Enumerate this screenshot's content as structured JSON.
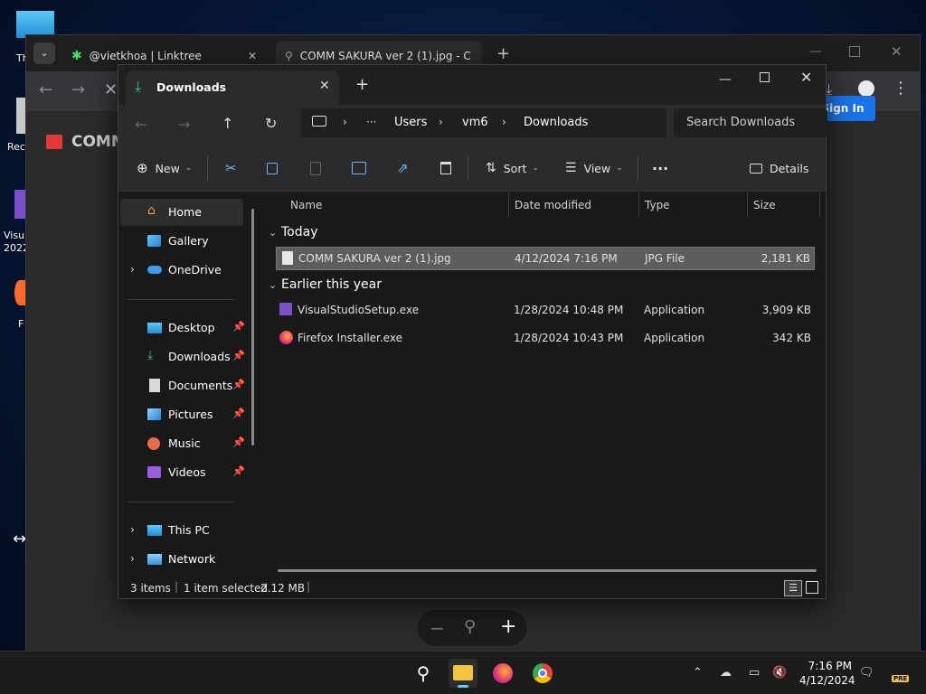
{
  "desktop": {
    "icons": [
      {
        "label": "Th"
      },
      {
        "label": "Rec"
      },
      {
        "label": "Visu 2022"
      },
      {
        "label": "F"
      }
    ]
  },
  "browser": {
    "tabs": [
      {
        "title": "@vietkhoa | Linktree",
        "active": false
      },
      {
        "title": "COMM SAKURA ver 2 (1).jpg - C",
        "active": true
      }
    ],
    "page_heading": "COMM",
    "sign_in_label": "Sign In",
    "zoom_minus": "−",
    "zoom_icon": "zoom-icon",
    "zoom_plus": "+"
  },
  "explorer": {
    "tab_title": "Downloads",
    "path": [
      "Users",
      "vm6",
      "Downloads"
    ],
    "path_more": "···",
    "search_placeholder": "Search Downloads",
    "commands": {
      "new": "New",
      "sort": "Sort",
      "view": "View",
      "more": "···",
      "details": "Details"
    },
    "nav": {
      "top": [
        {
          "label": "Home",
          "selected": true
        },
        {
          "label": "Gallery"
        },
        {
          "label": "OneDrive"
        }
      ],
      "quick": [
        {
          "label": "Desktop"
        },
        {
          "label": "Downloads"
        },
        {
          "label": "Documents"
        },
        {
          "label": "Pictures"
        },
        {
          "label": "Music"
        },
        {
          "label": "Videos"
        }
      ],
      "bottom": [
        {
          "label": "This PC"
        },
        {
          "label": "Network"
        }
      ]
    },
    "columns": [
      "Name",
      "Date modified",
      "Type",
      "Size"
    ],
    "groups": [
      {
        "label": "Today",
        "rows": [
          {
            "name": "COMM SAKURA ver 2 (1).jpg",
            "date": "4/12/2024 7:16 PM",
            "type": "JPG File",
            "size": "2,181 KB",
            "selected": true
          }
        ]
      },
      {
        "label": "Earlier this year",
        "rows": [
          {
            "name": "VisualStudioSetup.exe",
            "date": "1/28/2024 10:48 PM",
            "type": "Application",
            "size": "3,909 KB"
          },
          {
            "name": "Firefox Installer.exe",
            "date": "1/28/2024 10:43 PM",
            "type": "Application",
            "size": "342 KB"
          }
        ]
      }
    ],
    "status": {
      "items": "3 items",
      "selected": "1 item selected",
      "size": "2.12 MB"
    }
  },
  "taskbar": {
    "time": "7:16 PM",
    "date": "4/12/2024",
    "badge": "PRE"
  },
  "colors": {
    "accent": "#1a73e8",
    "selection": "#5d5d5d",
    "download_green": "#35c28b",
    "folder_yellow": "#f3c440"
  }
}
